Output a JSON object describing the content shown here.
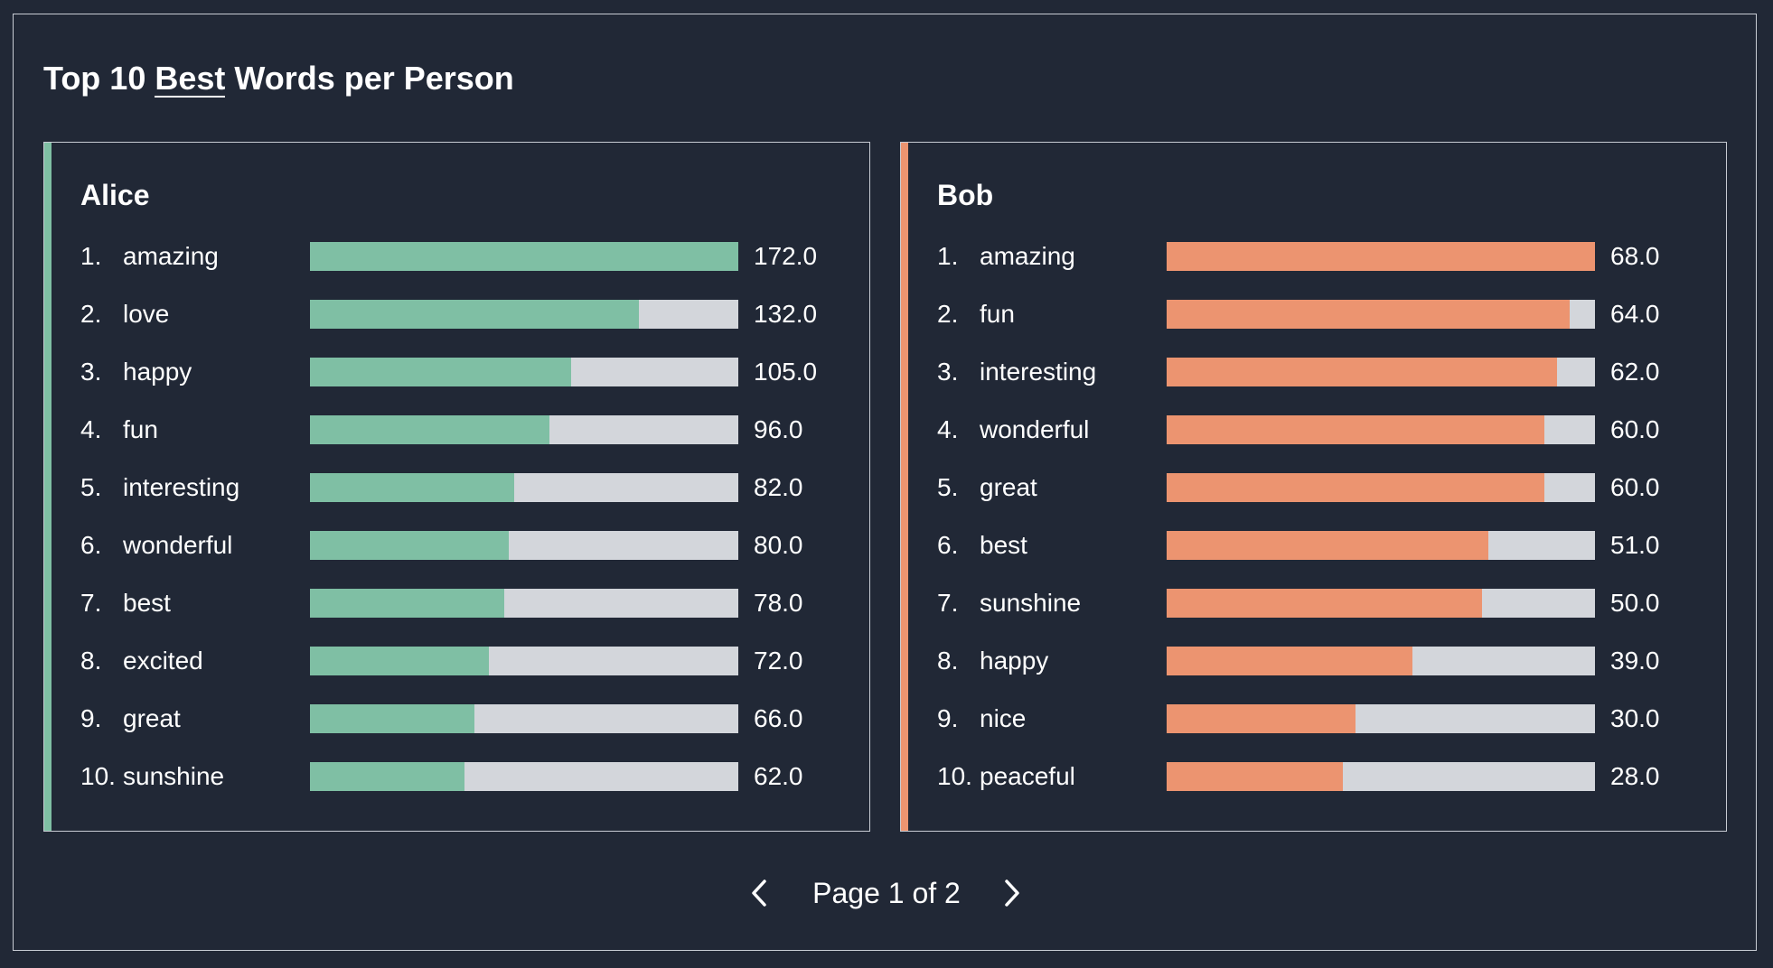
{
  "title": {
    "prefix": "Top 10",
    "selected": "Best",
    "suffix": "Words per Person"
  },
  "colors": {
    "alice": "#7fbfa4",
    "bob": "#ec9470",
    "track": "#d3d6db",
    "background": "#212836"
  },
  "chart_data": [
    {
      "type": "bar",
      "name": "Alice",
      "xlim": [
        0,
        172
      ],
      "ranks": [
        "1.",
        "2.",
        "3.",
        "4.",
        "5.",
        "6.",
        "7.",
        "8.",
        "9.",
        "10."
      ],
      "categories": [
        "amazing",
        "love",
        "happy",
        "fun",
        "interesting",
        "wonderful",
        "best",
        "excited",
        "great",
        "sunshine"
      ],
      "values": [
        172.0,
        132.0,
        105.0,
        96.0,
        82.0,
        80.0,
        78.0,
        72.0,
        66.0,
        62.0
      ],
      "value_labels": [
        "172.0",
        "132.0",
        "105.0",
        "96.0",
        "82.0",
        "80.0",
        "78.0",
        "72.0",
        "66.0",
        "62.0"
      ]
    },
    {
      "type": "bar",
      "name": "Bob",
      "xlim": [
        0,
        68
      ],
      "ranks": [
        "1.",
        "2.",
        "3.",
        "4.",
        "5.",
        "6.",
        "7.",
        "8.",
        "9.",
        "10."
      ],
      "categories": [
        "amazing",
        "fun",
        "interesting",
        "wonderful",
        "great",
        "best",
        "sunshine",
        "happy",
        "nice",
        "peaceful"
      ],
      "values": [
        68.0,
        64.0,
        62.0,
        60.0,
        60.0,
        51.0,
        50.0,
        39.0,
        30.0,
        28.0
      ],
      "value_labels": [
        "68.0",
        "64.0",
        "62.0",
        "60.0",
        "60.0",
        "51.0",
        "50.0",
        "39.0",
        "30.0",
        "28.0"
      ]
    }
  ],
  "pagination": {
    "label": "Page 1 of 2",
    "prev_icon": "chevron-left-icon",
    "next_icon": "chevron-right-icon"
  }
}
